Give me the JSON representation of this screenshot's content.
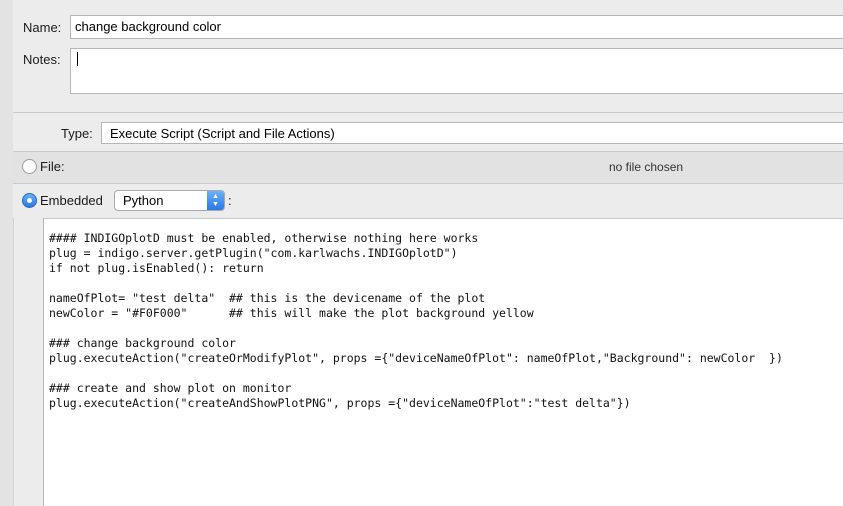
{
  "form": {
    "name_label": "Name:",
    "name_value": "change background color",
    "notes_label": "Notes:",
    "notes_value": "",
    "type_label": "Type:",
    "type_value": "Execute Script (Script and File Actions)",
    "file_label": "File:",
    "file_status": "no file chosen",
    "embedded_label": "Embedded",
    "language_value": "Python",
    "language_suffix": ":"
  },
  "script": {
    "lines": [
      "#### INDIGOplotD must be enabled, otherwise nothing here works",
      "plug = indigo.server.getPlugin(\"com.karlwachs.INDIGOplotD\")",
      "if not plug.isEnabled(): return",
      "",
      "nameOfPlot= \"test delta\"  ## this is the devicename of the plot",
      "newColor = \"#F0F000\"      ## this will make the plot background yellow",
      "",
      "### change background color",
      "plug.executeAction(\"createOrModifyPlot\", props ={\"deviceNameOfPlot\": nameOfPlot,\"Background\": newColor  })",
      "",
      "### create and show plot on monitor",
      "plug.executeAction(\"createAndShowPlotPNG\", props ={\"deviceNameOfPlot\":\"test delta\"})"
    ]
  }
}
